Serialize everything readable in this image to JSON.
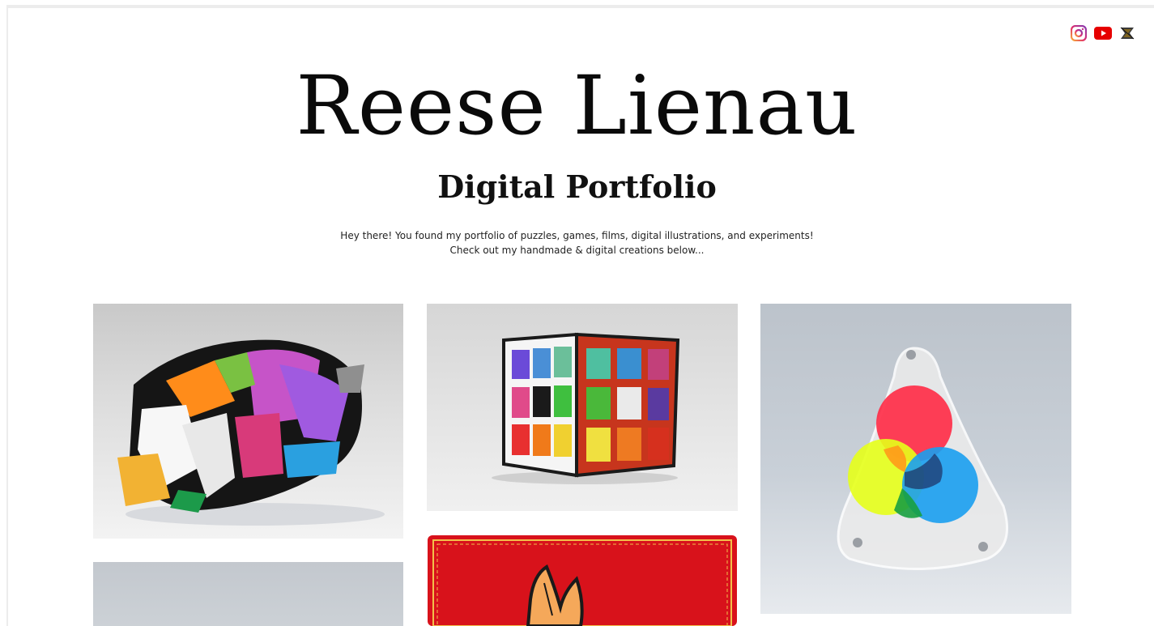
{
  "header": {
    "title": "Reese Lienau",
    "subtitle": "Digital Portfolio",
    "intro_line1": "Hey there! You found my portfolio of puzzles, games, films, digital illustrations, and experiments!",
    "intro_line2": "Check out my handmade & digital creations below..."
  },
  "socials": [
    {
      "icon": "instagram-icon"
    },
    {
      "icon": "youtube-icon"
    },
    {
      "icon": "puzzle-logo-icon"
    }
  ],
  "gallery": {
    "items": [
      {
        "icon": "twisty-puzzle-photo"
      },
      {
        "icon": "cube-puzzle-photo"
      },
      {
        "icon": "color-mixing-puzzle-photo"
      },
      {
        "icon": "puzzle-photo"
      },
      {
        "icon": "red-card-illustration"
      }
    ]
  },
  "colors": {
    "background": "#ffffff",
    "text": "#111111",
    "card_red": "#d8121b"
  }
}
